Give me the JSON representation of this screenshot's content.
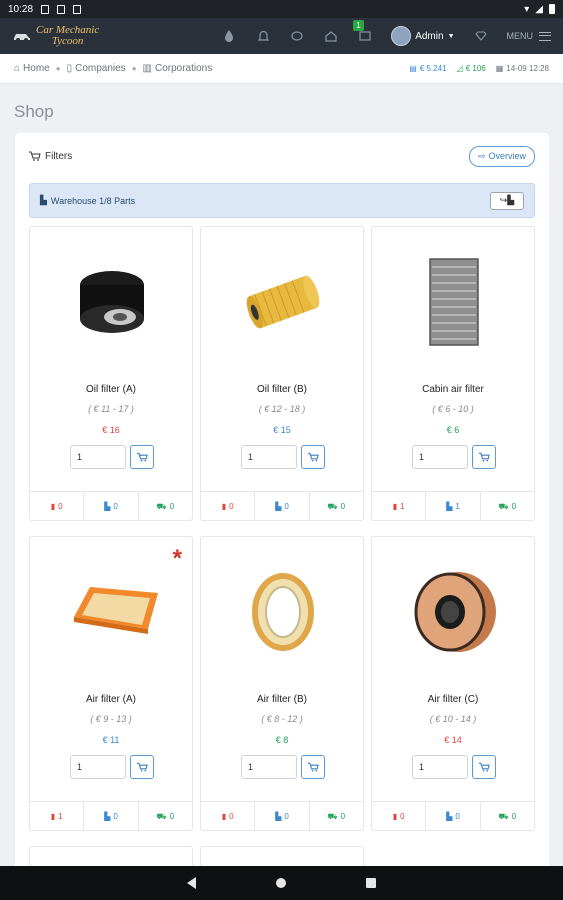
{
  "status_bar": {
    "time": "10:28"
  },
  "app": {
    "logo_line1": "Car Mechanic",
    "logo_line2": "Tycoon",
    "message_badge": "1",
    "admin_label": "Admin",
    "menu_label": "MENU"
  },
  "breadcrumb": {
    "home": "Home",
    "companies": "Companies",
    "corporations": "Corporations"
  },
  "stats": {
    "money": "€ 5.241",
    "wallet": "€ 106",
    "datetime": "14-09 12:28"
  },
  "page": {
    "title": "Shop"
  },
  "shop": {
    "filters_label": "Filters",
    "overview_label": "Overview",
    "warehouse_label": "Warehouse 1/8 Parts"
  },
  "products": [
    {
      "name": "Oil filter (A)",
      "range": "( € 11 - 17 )",
      "price": "€ 16",
      "price_color": "#e0453a",
      "qty": "1",
      "stock_red": "0",
      "stock_blue": "0",
      "stock_green": "0",
      "image": "oil-filter-black-icon",
      "starred": false
    },
    {
      "name": "Oil filter (B)",
      "range": "( € 12 - 18 )",
      "price": "€ 15",
      "price_color": "#3a88d0",
      "qty": "1",
      "stock_red": "0",
      "stock_blue": "0",
      "stock_green": "0",
      "image": "oil-filter-yellow-icon",
      "starred": false
    },
    {
      "name": "Cabin air filter",
      "range": "( € 6 - 10 )",
      "price": "€ 6",
      "price_color": "#22a35a",
      "qty": "1",
      "stock_red": "1",
      "stock_blue": "1",
      "stock_green": "0",
      "image": "cabin-filter-icon",
      "starred": false
    },
    {
      "name": "Air filter (A)",
      "range": "( € 9 - 13 )",
      "price": "€ 11",
      "price_color": "#3a88d0",
      "qty": "1",
      "stock_red": "1",
      "stock_blue": "0",
      "stock_green": "0",
      "image": "air-filter-panel-icon",
      "starred": true
    },
    {
      "name": "Air filter (B)",
      "range": "( € 8 - 12 )",
      "price": "€ 8",
      "price_color": "#22a35a",
      "qty": "1",
      "stock_red": "0",
      "stock_blue": "0",
      "stock_green": "0",
      "image": "air-filter-ring-icon",
      "starred": false
    },
    {
      "name": "Air filter (C)",
      "range": "( € 10 - 14 )",
      "price": "€ 14",
      "price_color": "#e0453a",
      "qty": "1",
      "stock_red": "0",
      "stock_blue": "0",
      "stock_green": "0",
      "image": "air-filter-round-icon",
      "starred": false
    }
  ]
}
